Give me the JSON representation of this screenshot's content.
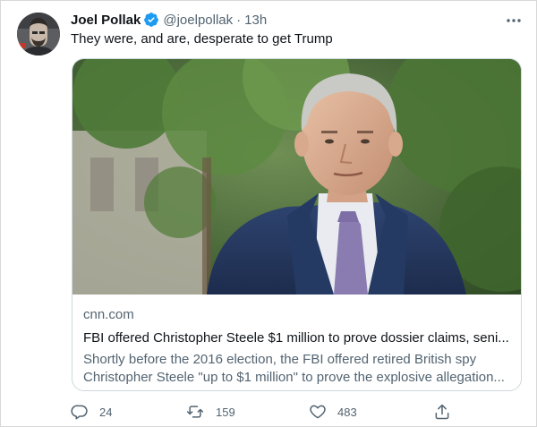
{
  "tweet": {
    "author_name": "Joel Pollak",
    "handle": "@joelpollak",
    "separator": "·",
    "time": "13h",
    "text": "They were, and are, desperate to get Trump"
  },
  "card": {
    "domain": "cnn.com",
    "title": "FBI offered Christopher Steele $1 million to prove dossier claims, seni...",
    "description_line1": "Shortly before the 2016 election, the FBI offered retired British spy",
    "description_line2": "Christopher Steele \"up to $1 million\" to prove the explosive allegation..."
  },
  "actions": {
    "reply_count": "24",
    "retweet_count": "159",
    "like_count": "483"
  },
  "icons": {
    "verified": "verified-badge-icon",
    "more": "more-horizontal-icon",
    "reply": "reply-icon",
    "retweet": "retweet-icon",
    "like": "heart-icon",
    "share": "share-icon"
  },
  "colors": {
    "verified_blue": "#1d9bf0",
    "secondary_text": "#536471",
    "primary_text": "#0f1419",
    "border": "#cfd9de"
  }
}
